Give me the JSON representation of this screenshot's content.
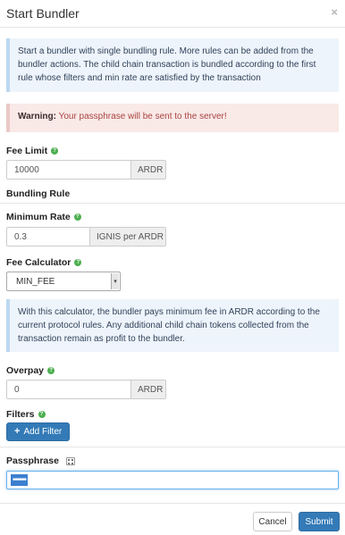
{
  "modal": {
    "title": "Start Bundler",
    "close_symbol": "×"
  },
  "info_top": "Start a bundler with single bundling rule. More rules can be added from the bundler actions. The child chain transaction is bundled according to the first rule whose filters and min rate are satisfied by the transaction",
  "warning": {
    "prefix": "Warning:",
    "text": " Your passphrase will be sent to the server!"
  },
  "fee_limit": {
    "label": "Fee Limit",
    "value": "10000",
    "unit": "ARDR"
  },
  "bundling_rule": {
    "heading": "Bundling Rule"
  },
  "minimum_rate": {
    "label": "Minimum Rate",
    "value": "0.3",
    "unit": "IGNIS per ARDR"
  },
  "fee_calculator": {
    "label": "Fee Calculator",
    "selected": "MIN_FEE",
    "arrow_symbol": "▾"
  },
  "info_calc": "With this calculator, the bundler pays minimum fee in ARDR according to the current protocol rules. Any additional child chain tokens collected from the transaction remain as profit to the bundler.",
  "overpay": {
    "label": "Overpay",
    "value": "0",
    "unit": "ARDR"
  },
  "filters": {
    "label": "Filters",
    "add_button": "Add Filter",
    "plus_symbol": "+"
  },
  "passphrase": {
    "label": "Passphrase",
    "masked_value": "••••••"
  },
  "footer": {
    "cancel": "Cancel",
    "submit": "Submit"
  },
  "icons": {
    "help": "question-circle-icon",
    "qr": "qrcode-icon",
    "close": "close-icon",
    "plus": "plus-icon"
  },
  "colors": {
    "primary": "#337ab7",
    "info_bg": "#eef4fb",
    "warning_bg": "#f9e9e7",
    "help_green": "#4caf50"
  }
}
